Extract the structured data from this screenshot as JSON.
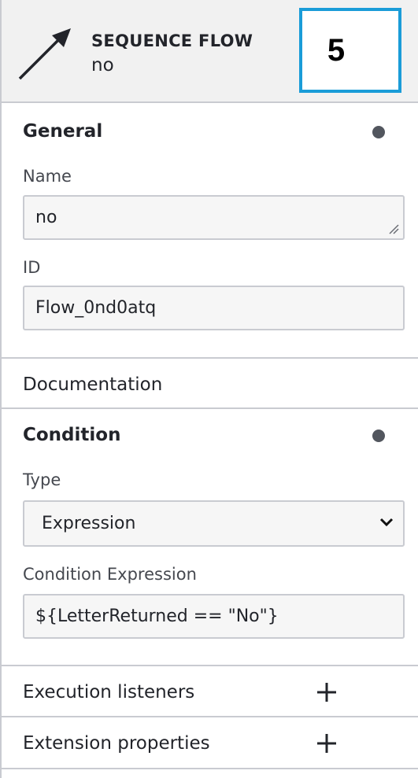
{
  "header": {
    "element_type": "SEQUENCE FLOW",
    "element_name": "no",
    "icon": "sequence-flow-arrow-icon",
    "step_badge": "5"
  },
  "general": {
    "title": "General",
    "name_label": "Name",
    "name_value": "no",
    "id_label": "ID",
    "id_value": "Flow_0nd0atq"
  },
  "documentation": {
    "title": "Documentation"
  },
  "condition": {
    "title": "Condition",
    "type_label": "Type",
    "type_value": "Expression",
    "expression_label": "Condition Expression",
    "expression_value": "${LetterReturned == \"No\"}"
  },
  "execution_listeners": {
    "title": "Execution listeners",
    "add_icon": "plus-icon"
  },
  "extension_properties": {
    "title": "Extension properties",
    "add_icon": "plus-icon"
  },
  "colors": {
    "badge_border": "#1a9cd8",
    "dot": "#52565e",
    "header_bg": "#f1f1f1"
  }
}
